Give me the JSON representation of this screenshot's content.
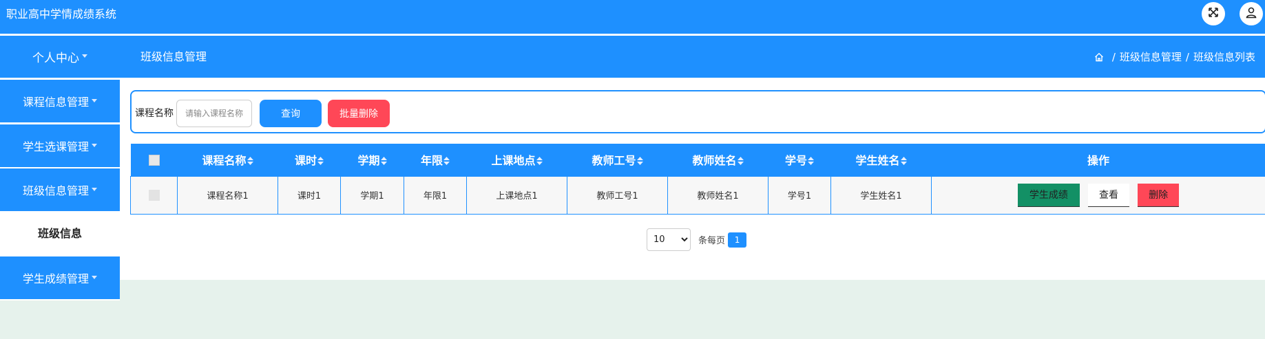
{
  "app": {
    "title": "职业高中学情成绩系统"
  },
  "topbar": {
    "fullscreen_icon": "expand-arrows-icon",
    "user_icon": "user-icon"
  },
  "header": {
    "center_link": "个人中心",
    "page_title": "班级信息管理",
    "breadcrumb": [
      "班级信息管理",
      "班级信息列表"
    ],
    "breadcrumb_sep": "/"
  },
  "sidebar": {
    "items": [
      {
        "label": "课程信息管理"
      },
      {
        "label": "学生选课管理"
      },
      {
        "label": "班级信息管理"
      },
      {
        "label": "班级信息",
        "active": true
      },
      {
        "label": "学生成绩管理"
      }
    ]
  },
  "search": {
    "label": "课程名称",
    "placeholder": "请输入课程名称",
    "value": "",
    "query_btn": "查询",
    "batch_delete_btn": "批量删除"
  },
  "table": {
    "columns": [
      "课程名称",
      "课时",
      "学期",
      "年限",
      "上课地点",
      "教师工号",
      "教师姓名",
      "学号",
      "学生姓名"
    ],
    "action_header": "操作",
    "rows": [
      {
        "cells": [
          "课程名称1",
          "课时1",
          "学期1",
          "年限1",
          "上课地点1",
          "教师工号1",
          "教师姓名1",
          "学号1",
          "学生姓名1"
        ]
      }
    ],
    "row_actions": {
      "score": "学生成绩",
      "view": "查看",
      "delete": "删除"
    }
  },
  "pager": {
    "page_size": "10",
    "page_size_options": [
      "10"
    ],
    "per_page_label": "条每页",
    "current_page": "1"
  },
  "colors": {
    "primary": "#1e90ff",
    "danger": "#ff4757",
    "success": "#139065",
    "page_bg": "#e6f2ec"
  }
}
